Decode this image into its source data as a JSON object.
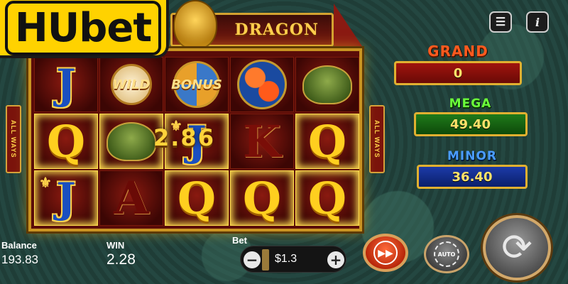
{
  "brand": {
    "logo_text": "HUbet"
  },
  "game": {
    "title": "DRAGON",
    "side_label": "ALL WAYS"
  },
  "topbar": {
    "menu_icon": "menu-icon",
    "info_icon": "info-icon",
    "info_glyph": "i"
  },
  "reels": {
    "rows": [
      [
        "J",
        "WILD",
        "BONUS",
        "koi",
        "toad"
      ],
      [
        "Q",
        "toad",
        "J",
        "K",
        "Q"
      ],
      [
        "J",
        "A",
        "Q",
        "Q",
        "Q"
      ]
    ],
    "win_display": "2.86"
  },
  "jackpots": {
    "grand": {
      "label": "GRAND",
      "value": "0"
    },
    "mega": {
      "label": "MEGA",
      "value": "49.40"
    },
    "minor": {
      "label": "MINOR",
      "value": "36.40"
    }
  },
  "footer": {
    "balance_label": "Balance",
    "balance_value": "193.83",
    "win_label": "WIN",
    "win_value": "2.28",
    "bet_label": "Bet",
    "bet_value": "$1.3",
    "bet_minus": "−",
    "bet_plus": "+",
    "auto_label": "AUTO"
  },
  "colors": {
    "grand": "#a0140e",
    "mega": "#1f7a1a",
    "minor": "#1c3aa8",
    "gold": "#ffd33a"
  }
}
